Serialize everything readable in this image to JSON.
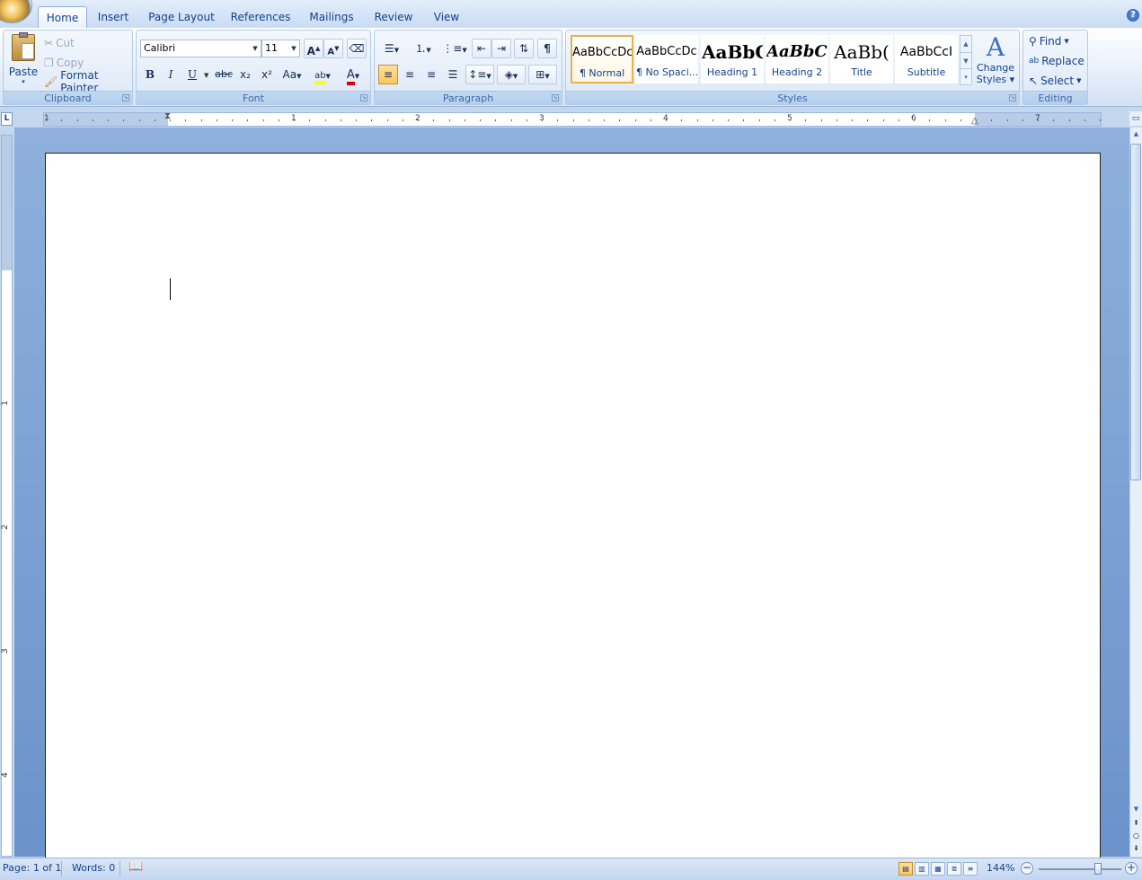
{
  "tabs": [
    {
      "label": "Home",
      "active": true
    },
    {
      "label": "Insert"
    },
    {
      "label": "Page Layout"
    },
    {
      "label": "References"
    },
    {
      "label": "Mailings"
    },
    {
      "label": "Review"
    },
    {
      "label": "View"
    }
  ],
  "clipboard": {
    "paste": "Paste",
    "cut": "Cut",
    "copy": "Copy",
    "format_painter": "Format Painter",
    "group": "Clipboard"
  },
  "font": {
    "name": "Calibri",
    "size": "11",
    "group": "Font",
    "bold": "B",
    "italic": "I",
    "underline": "U",
    "strike": "abc",
    "subscript": "x₂",
    "superscript": "x²",
    "change_case": "Aa",
    "highlight_color": "#ffff00",
    "font_color": "#e00000"
  },
  "paragraph": {
    "group": "Paragraph",
    "show_marks": "¶"
  },
  "styles": {
    "group": "Styles",
    "items": [
      {
        "sample": "AaBbCcDc",
        "name": "¶ Normal",
        "selected": true
      },
      {
        "sample": "AaBbCcDc",
        "name": "¶ No Spaci..."
      },
      {
        "sample": "AaBbC",
        "name": "Heading 1"
      },
      {
        "sample": "AaBbCc",
        "name": "Heading 2"
      },
      {
        "sample": "AaBb(",
        "name": "Title"
      },
      {
        "sample": "AaBbCcI",
        "name": "Subtitle"
      }
    ],
    "change_styles": "Change",
    "change_styles_2": "Styles"
  },
  "editing": {
    "group": "Editing",
    "find": "Find",
    "replace": "Replace",
    "select": "Select"
  },
  "ruler": {
    "numbers": [
      "1",
      "1",
      "2",
      "3",
      "4",
      "5",
      "6",
      "7"
    ],
    "corner": "L"
  },
  "vruler": {
    "numbers": [
      "1",
      "2",
      "3",
      "4"
    ]
  },
  "status": {
    "page": "Page: 1 of 1",
    "words": "Words: 0",
    "zoom": "144%",
    "zoom_level_fraction": 0.72
  },
  "help": "?"
}
